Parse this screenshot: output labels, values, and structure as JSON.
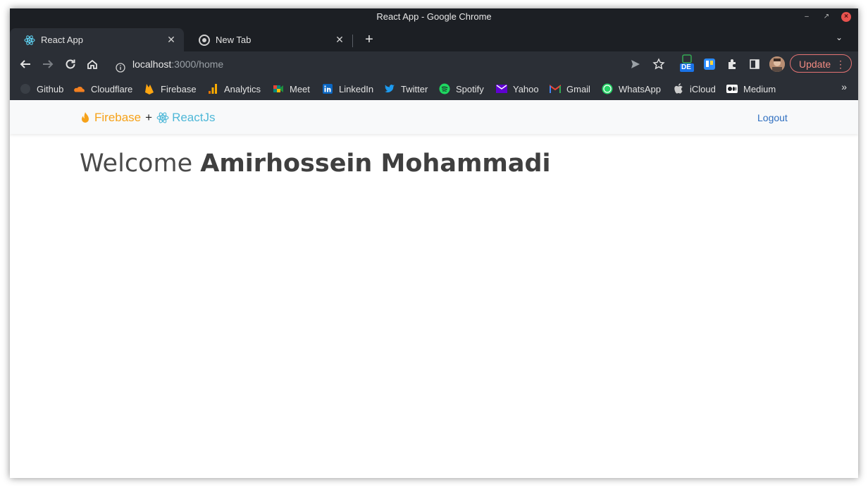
{
  "window": {
    "title": "React App - Google Chrome"
  },
  "tabs": [
    {
      "label": "React App",
      "icon": "react-icon",
      "active": true
    },
    {
      "label": "New Tab",
      "icon": "chrome-icon",
      "active": false
    }
  ],
  "toolbar": {
    "url_host": "localhost",
    "url_path": ":3000/home",
    "update_label": "Update"
  },
  "extensions": {
    "de_badge": "DE"
  },
  "bookmarks": [
    {
      "label": "Github",
      "icon": "github-icon",
      "color": "#1c1f24"
    },
    {
      "label": "Cloudflare",
      "icon": "cloudflare-icon",
      "color": "#f38020"
    },
    {
      "label": "Firebase",
      "icon": "firebase-icon",
      "color": "#ffa611"
    },
    {
      "label": "Analytics",
      "icon": "analytics-icon",
      "color": "#f9ab00"
    },
    {
      "label": "Meet",
      "icon": "meet-icon",
      "color": "#00897b"
    },
    {
      "label": "LinkedIn",
      "icon": "linkedin-icon",
      "color": "#0a66c2"
    },
    {
      "label": "Twitter",
      "icon": "twitter-icon",
      "color": "#1d9bf0"
    },
    {
      "label": "Spotify",
      "icon": "spotify-icon",
      "color": "#1ed760"
    },
    {
      "label": "Yahoo",
      "icon": "yahoo-icon",
      "color": "#6001d2"
    },
    {
      "label": "Gmail",
      "icon": "gmail-icon",
      "color": "#ea4335"
    },
    {
      "label": "WhatsApp",
      "icon": "whatsapp-icon",
      "color": "#25d366"
    },
    {
      "label": "iCloud",
      "icon": "apple-icon",
      "color": "#cccccc"
    },
    {
      "label": "Medium",
      "icon": "medium-icon",
      "color": "#ffffff"
    }
  ],
  "app": {
    "brand_firebase": "Firebase",
    "brand_plus": "+",
    "brand_react": "ReactJs",
    "logout_label": "Logout",
    "welcome_word": "Welcome",
    "user_name": "Amirhossein Mohammadi"
  },
  "colors": {
    "firebase_orange": "#f6a21a",
    "react_blue": "#4fb8d8",
    "link_blue": "#2f6fc0"
  }
}
